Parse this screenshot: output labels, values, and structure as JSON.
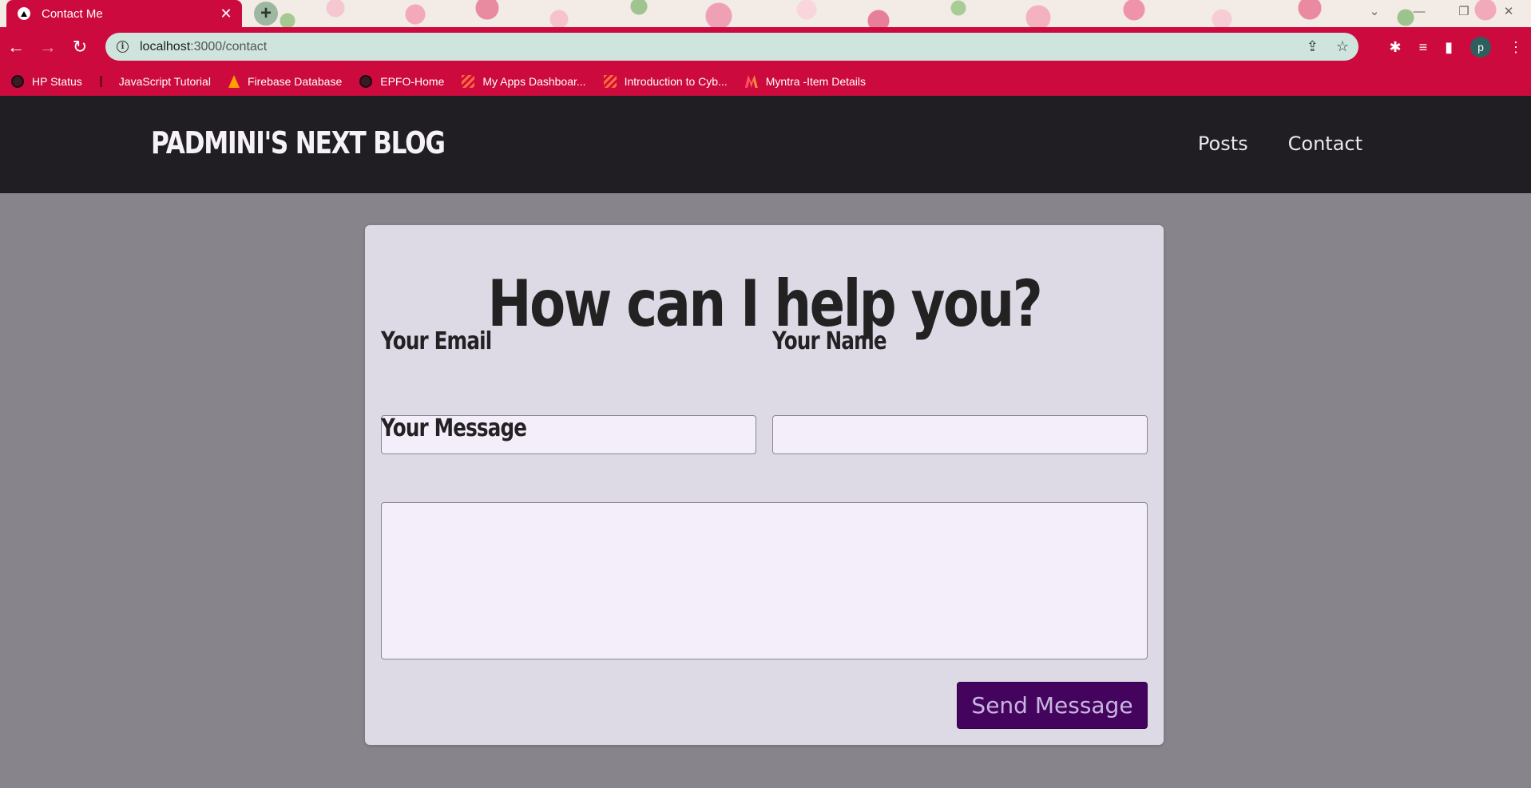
{
  "browser": {
    "tab_title": "Contact Me",
    "tab_close": "✕",
    "newtab": "+",
    "url_host": "localhost",
    "url_path": ":3000/contact",
    "profile_initial": "p",
    "bookmarks": [
      {
        "label": "HP Status",
        "icon": "globe-icon"
      },
      {
        "label": "JavaScript Tutorial",
        "icon": "js-icon"
      },
      {
        "label": "Firebase Database",
        "icon": "firebase-icon"
      },
      {
        "label": "EPFO-Home",
        "icon": "globe-icon"
      },
      {
        "label": "My Apps Dashboar...",
        "icon": "stripes-icon"
      },
      {
        "label": "Introduction to Cyb...",
        "icon": "stripes-icon"
      },
      {
        "label": "Myntra -Item Details",
        "icon": "myntra-icon"
      }
    ]
  },
  "header": {
    "logo": "PADMINI'S NEXT BLOG",
    "nav": [
      "Posts",
      "Contact"
    ]
  },
  "contact": {
    "title": "How can I help you?",
    "email_label": "Your Email",
    "email_value": "",
    "name_label": "Your Name",
    "name_value": "",
    "message_label": "Your Message",
    "message_value": "",
    "submit_label": "Send Message"
  },
  "colors": {
    "browser_accent": "#cc0a3e",
    "header_bg": "#201e22",
    "page_bg": "#87848c",
    "card_bg": "#ddd9e5",
    "button_bg": "#44045e"
  }
}
